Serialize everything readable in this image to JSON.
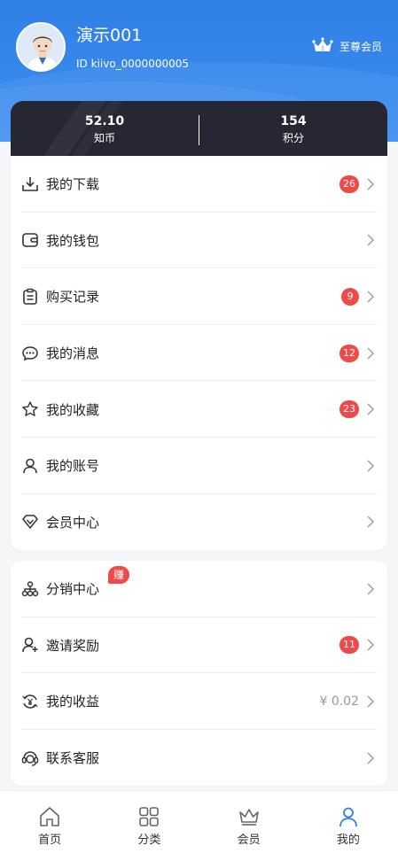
{
  "profile": {
    "name": "演示001",
    "id_text": "ID kiivo_0000000005",
    "vip_label": "至尊会员"
  },
  "stats": [
    {
      "value": "52.10",
      "label": "知币"
    },
    {
      "value": "154",
      "label": "积分"
    }
  ],
  "menu_main": [
    {
      "label": "我的下载",
      "badge": "26",
      "icon": "download-icon"
    },
    {
      "label": "我的钱包",
      "badge": "",
      "icon": "wallet-icon"
    },
    {
      "label": "购买记录",
      "badge": "9",
      "icon": "clipboard-icon"
    },
    {
      "label": "我的消息",
      "badge": "12",
      "icon": "message-icon"
    },
    {
      "label": "我的收藏",
      "badge": "23",
      "icon": "star-icon"
    },
    {
      "label": "我的账号",
      "badge": "",
      "icon": "user-icon"
    },
    {
      "label": "会员中心",
      "badge": "",
      "icon": "diamond-icon"
    }
  ],
  "menu_extra": [
    {
      "label": "分销中心",
      "tag": "赚",
      "icon": "network-icon"
    },
    {
      "label": "邀请奖励",
      "badge": "11",
      "icon": "invite-user-icon"
    },
    {
      "label": "我的收益",
      "amount": "¥ 0.02",
      "icon": "earnings-icon"
    },
    {
      "label": "联系客服",
      "icon": "headset-icon"
    }
  ],
  "tabbar": [
    {
      "label": "首页",
      "icon": "home-icon"
    },
    {
      "label": "分类",
      "icon": "grid-icon"
    },
    {
      "label": "会员",
      "icon": "crown-icon"
    },
    {
      "label": "我的",
      "icon": "profile-icon",
      "active": true
    }
  ],
  "colors": {
    "header_blue": "#2f7fe6",
    "stats_dark": "#262733",
    "badge_red": "#ef4a4a",
    "active_tab": "#2f7fe6"
  }
}
